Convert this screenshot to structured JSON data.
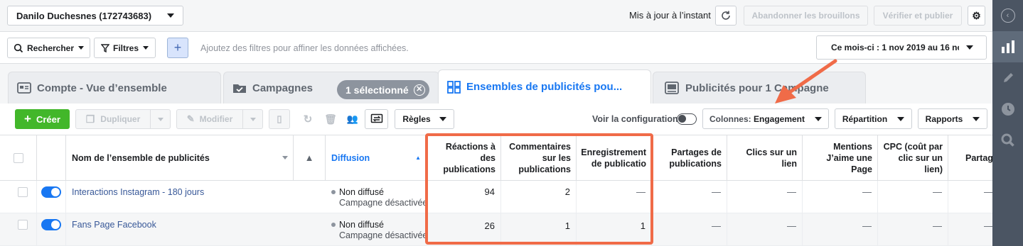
{
  "topbar": {
    "account": "Danilo Duchesnes (172743683)",
    "updated": "Mis à jour à l’instant",
    "discard": "Abandonner les brouillons",
    "publish": "Vérifier et publier"
  },
  "filterbar": {
    "search": "Rechercher",
    "filters": "Filtres",
    "add": "+",
    "hint": "Ajoutez des filtres pour affiner les données affichées.",
    "date_range": "Ce mois-ci : 1 nov 2019 au 16 no"
  },
  "tabs": {
    "account": "Compte - Vue d’ensemble",
    "campaigns": "Campagnes",
    "selected_badge": "1 sélectionné",
    "adsets": "Ensembles de publicités pou...",
    "ads": "Publicités pour 1 Campagne"
  },
  "toolbar": {
    "create": "Créer",
    "duplicate": "Dupliquer",
    "edit": "Modifier",
    "rules": "Règles",
    "view_config": "Voir la configuration",
    "columns_prefix": "Colonnes: ",
    "columns_value": "Engagement",
    "breakdown": "Répartition",
    "reports": "Rapports"
  },
  "table": {
    "headers": {
      "name": "Nom de l’ensemble de publicités",
      "delivery": "Diffusion",
      "reactions": [
        "Réactions à",
        "des",
        "publications"
      ],
      "comments": [
        "Commentaires",
        "sur les",
        "publications"
      ],
      "saves": [
        "Enregistrement",
        "de publicatio"
      ],
      "shares": [
        "Partages de",
        "publications"
      ],
      "link_clicks": [
        "Clics sur un",
        "lien"
      ],
      "page_likes": [
        "Mentions",
        "J’aime une",
        "Page"
      ],
      "cpc": [
        "CPC (coût par",
        "clic sur un",
        "lien)"
      ],
      "partial": "Partag"
    },
    "rows": [
      {
        "name": "Interactions Instagram - 180 jours",
        "status": "Non diffusé",
        "status_sub": "Campagne désactivée",
        "reactions": "94",
        "comments": "2",
        "saves": "—",
        "shares": "—",
        "link_clicks": "—",
        "page_likes": "—",
        "cpc": "—",
        "partial": "—"
      },
      {
        "name": "Fans Page Facebook",
        "status": "Non diffusé",
        "status_sub": "Campagne désactivée",
        "reactions": "26",
        "comments": "1",
        "saves": "1",
        "shares": "—",
        "link_clicks": "—",
        "page_likes": "—",
        "cpc": "—",
        "partial": "—"
      }
    ]
  },
  "colors": {
    "accent": "#1877f2",
    "create_green": "#42b72a",
    "highlight": "#f06b48",
    "sidebar": "#4b5563"
  }
}
